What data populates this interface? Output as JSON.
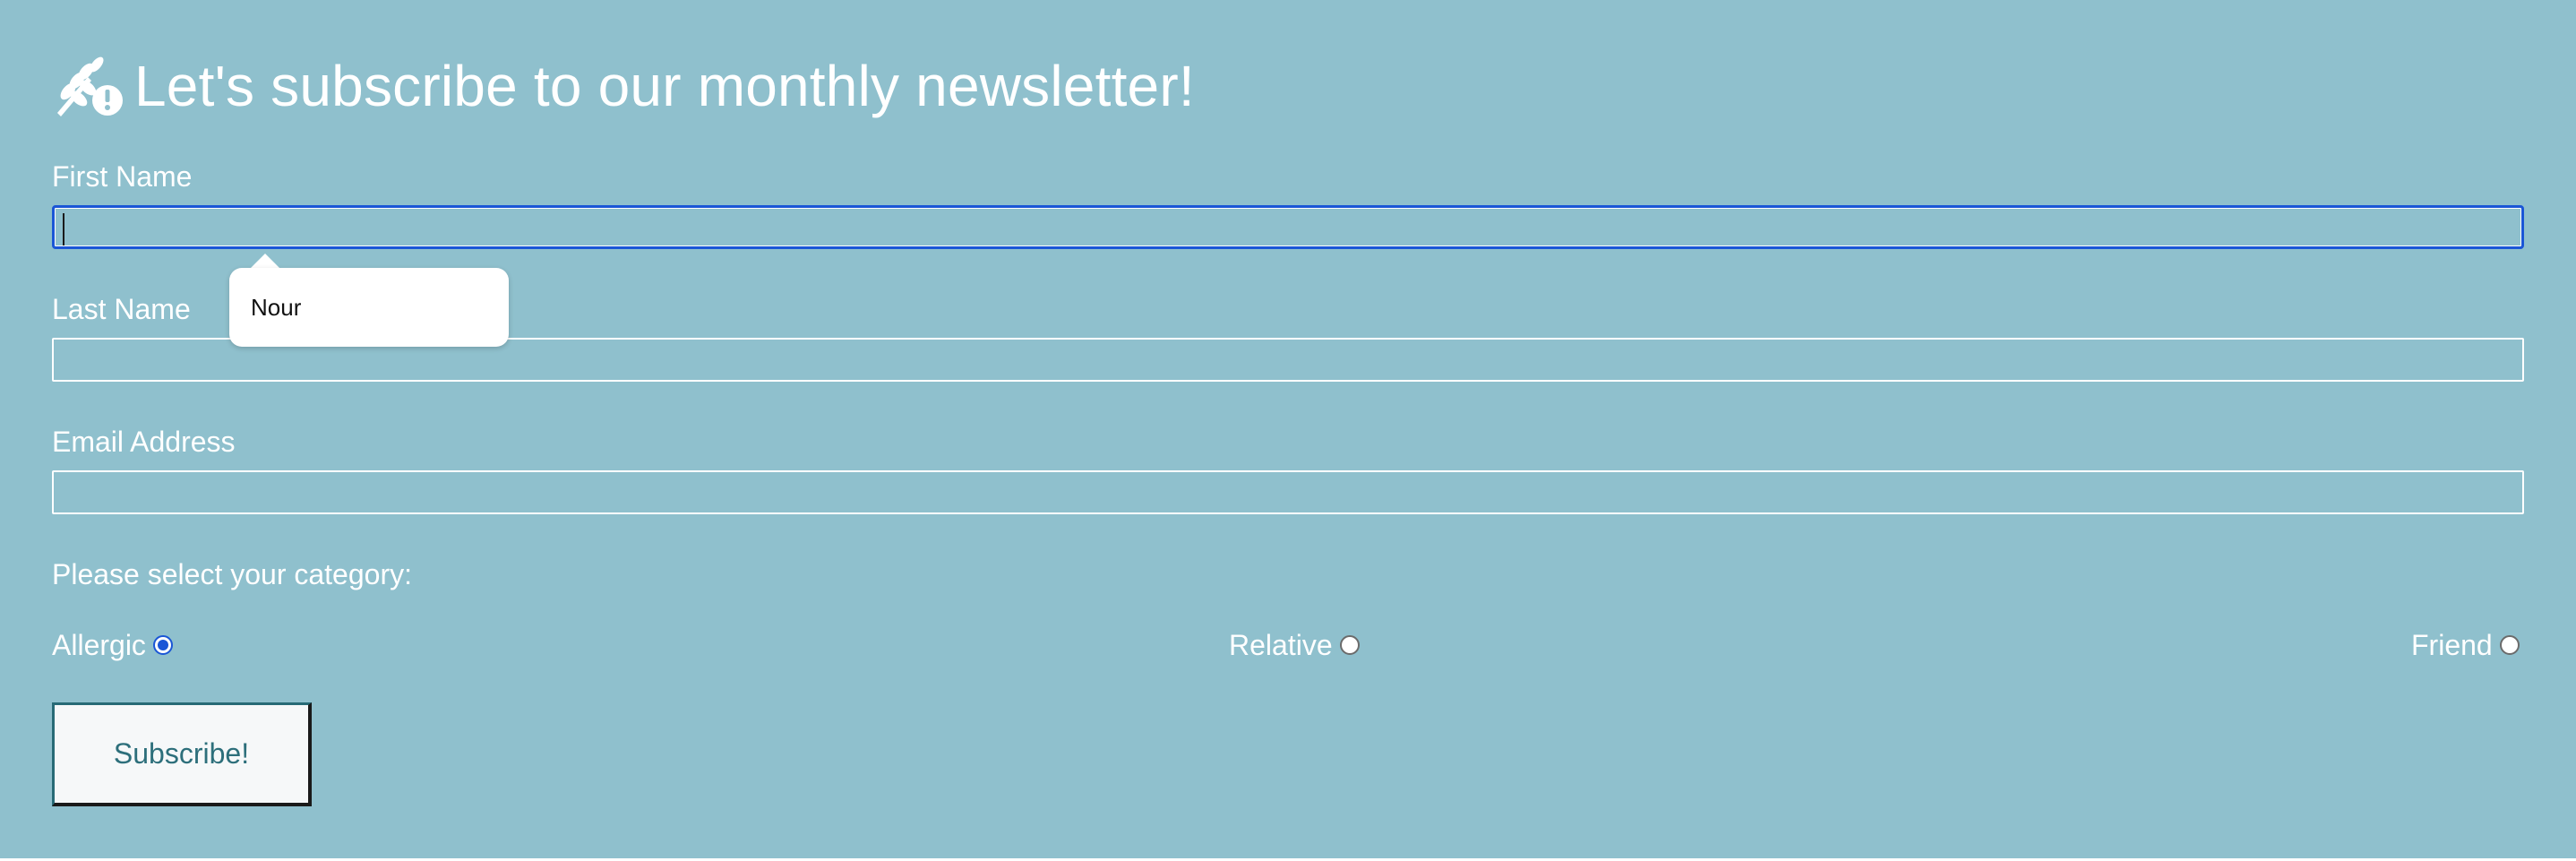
{
  "header": {
    "title": "Let's subscribe to our monthly newsletter!",
    "icon": "allergen-warning-icon"
  },
  "form": {
    "first_name": {
      "label": "First Name",
      "value": ""
    },
    "autocomplete": {
      "suggestion": "Nour"
    },
    "last_name": {
      "label": "Last Name",
      "value": ""
    },
    "email": {
      "label": "Email Address",
      "value": ""
    },
    "category": {
      "prompt": "Please select your category:",
      "options": [
        {
          "label": "Allergic",
          "checked": true
        },
        {
          "label": "Relative",
          "checked": false
        },
        {
          "label": "Friend",
          "checked": false
        }
      ]
    },
    "submit_label": "Subscribe!"
  },
  "colors": {
    "background": "#8fc0cd",
    "text": "#ffffff",
    "focus": "#1a56d6",
    "button_text": "#2d6f7b"
  }
}
